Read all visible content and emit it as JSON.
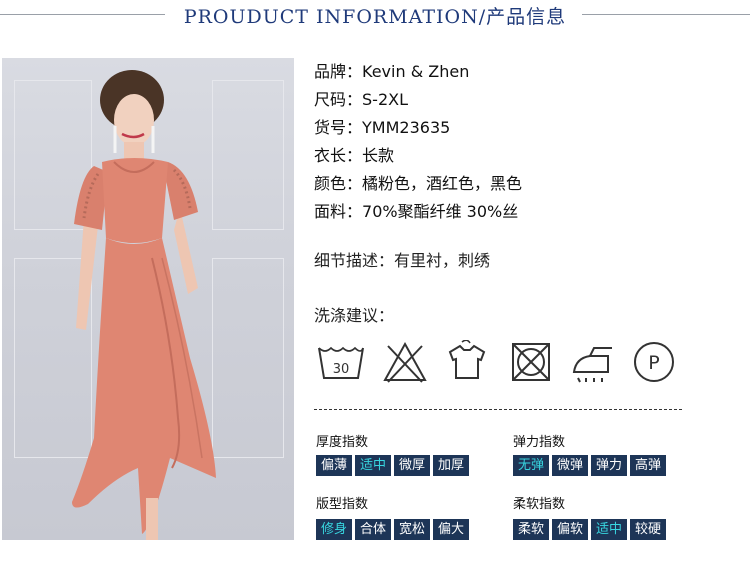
{
  "header": {
    "title": "PROUDUCT INFORMATION/产品信息"
  },
  "specs": [
    {
      "key": "品牌：",
      "value": "Kevin & Zhen"
    },
    {
      "key": "尺码：",
      "value": "S-2XL"
    },
    {
      "key": "货号：",
      "value": "YMM23635"
    },
    {
      "key": "衣长：",
      "value": "长款"
    },
    {
      "key": "颜色：",
      "value": "橘粉色，酒红色，黑色"
    },
    {
      "key": "面料：",
      "value": "70%聚酯纤维 30%丝"
    }
  ],
  "detail": {
    "label": "细节描述：",
    "value": "有里衬，刺绣"
  },
  "washing": {
    "title": "洗涤建议：",
    "icons": [
      "wash-30-icon",
      "no-bleach-icon",
      "hang-dry-icon",
      "no-tumble-dry-icon",
      "iron-icon",
      "dry-clean-p-icon"
    ],
    "temp": "30",
    "p_letter": "P"
  },
  "indices": [
    {
      "title": "厚度指数",
      "options": [
        "偏薄",
        "适中",
        "微厚",
        "加厚"
      ],
      "selected": 1
    },
    {
      "title": "弹力指数",
      "options": [
        "无弹",
        "微弹",
        "弹力",
        "高弹"
      ],
      "selected": 0
    },
    {
      "title": "版型指数",
      "options": [
        "修身",
        "合体",
        "宽松",
        "偏大"
      ],
      "selected": 0
    },
    {
      "title": "柔软指数",
      "options": [
        "柔软",
        "偏软",
        "适中",
        "较硬"
      ],
      "selected": 2
    }
  ],
  "colors": {
    "title": "#1f3a7a",
    "chip_bg": "#1d3557",
    "chip_on": "#38d6e0",
    "dress": "#df8672"
  }
}
